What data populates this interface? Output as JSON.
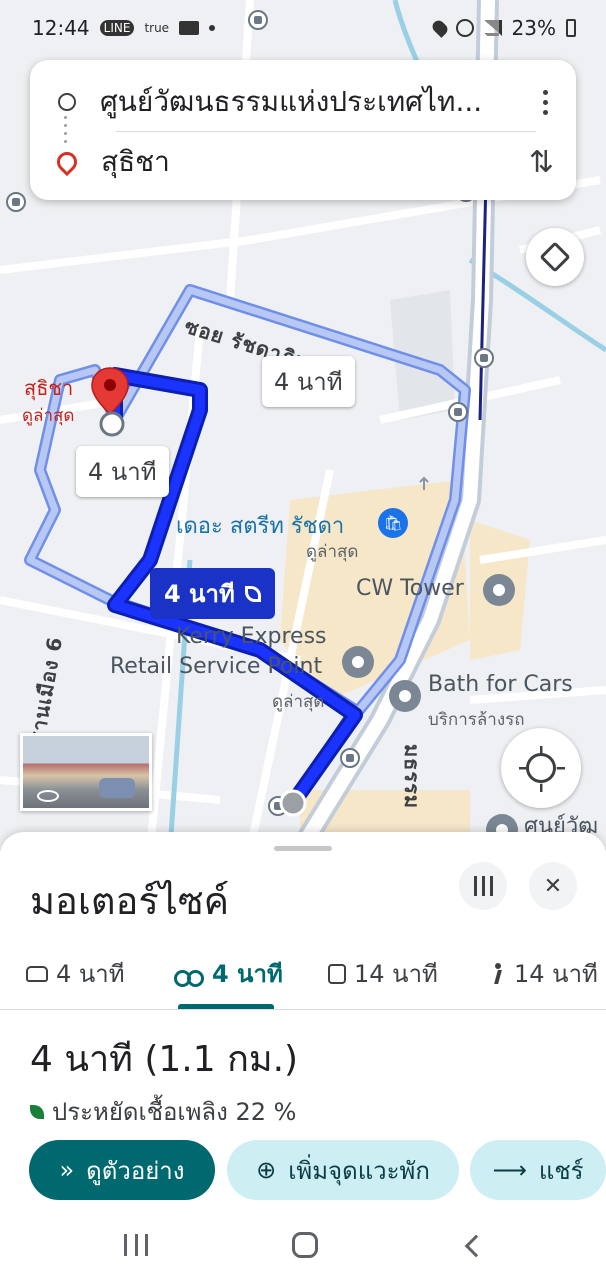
{
  "status_bar": {
    "time": "12:44",
    "app_chips": [
      "LINE",
      "true"
    ],
    "battery": "23%",
    "icons": [
      "line-icon",
      "true-icon",
      "mail-icon",
      "dot-icon",
      "location-icon",
      "wifi-call-icon",
      "signal-icon",
      "battery-icon"
    ]
  },
  "search": {
    "origin": "ศูนย์วัฒนธรรมแห่งประเทศไท...",
    "destination": "สุธิชา"
  },
  "map": {
    "destination_label": "สุธิชา",
    "destination_sub": "ดูล่าสุด",
    "street_name": "ซอย รัชดาภิเษก 7",
    "street_name_2": "ซอย ชานเมือง 6",
    "street_name_3": "มธรรม",
    "eta_alt_1": "4 นาที",
    "eta_alt_2": "4 นาที",
    "eta_main": "4 นาที",
    "pois": {
      "mall": "เดอะ สตรีท รัชดา",
      "mall_sub": "ดูล่าสุด",
      "tower": "CW Tower",
      "kerry_line1": "Kerry Express",
      "kerry_line2": "Retail Service Point",
      "kerry_sub": "ดูล่าสุด",
      "bath": "Bath for Cars",
      "bath_sub": "บริการล้างรถ",
      "cultural_partial": "ศูนย์วัฒ"
    },
    "colors": {
      "route_main": "#1a33ff",
      "route_alt": "#a8bff5",
      "eta_main_bg": "#1a33c6"
    }
  },
  "sheet": {
    "mode_title": "มอเตอร์ไซค์",
    "tabs": [
      {
        "icon": "car-icon",
        "label": "4 นาที",
        "active": false
      },
      {
        "icon": "motorcycle-icon",
        "label": "4 นาที",
        "active": true
      },
      {
        "icon": "transit-icon",
        "label": "14 นาที",
        "active": false
      },
      {
        "icon": "walk-icon",
        "label": "14 นาที",
        "active": false
      }
    ],
    "summary": "4 นาที (1.1 กม.)",
    "fuel_saving": "ประหยัดเชื้อเพลิง 22 %",
    "buttons": {
      "preview": "ดูตัวอย่าง",
      "add_stop": "เพิ่มจุดแวะพัก",
      "share": "แชร์"
    },
    "accent": "#00696f",
    "chip_bg": "#cdeef2"
  }
}
